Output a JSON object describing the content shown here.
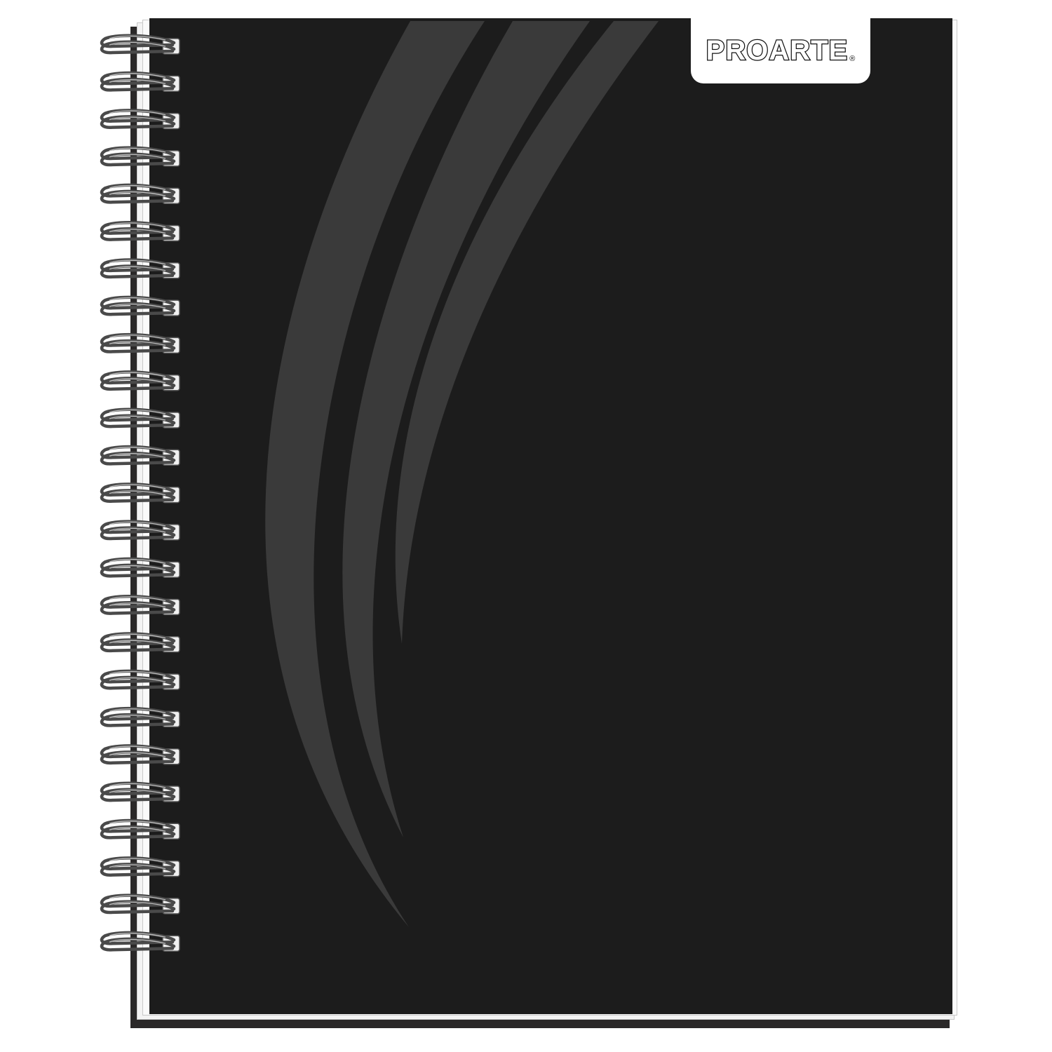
{
  "brand": {
    "name": "PROARTE",
    "registered_mark": "®"
  },
  "colors": {
    "cover": "#1c1c1c",
    "swoosh": "#3a3a3a",
    "logo_tab": "#ffffff",
    "spiral_wire": "#4a4a4a"
  },
  "spiral": {
    "coil_count": 25
  }
}
